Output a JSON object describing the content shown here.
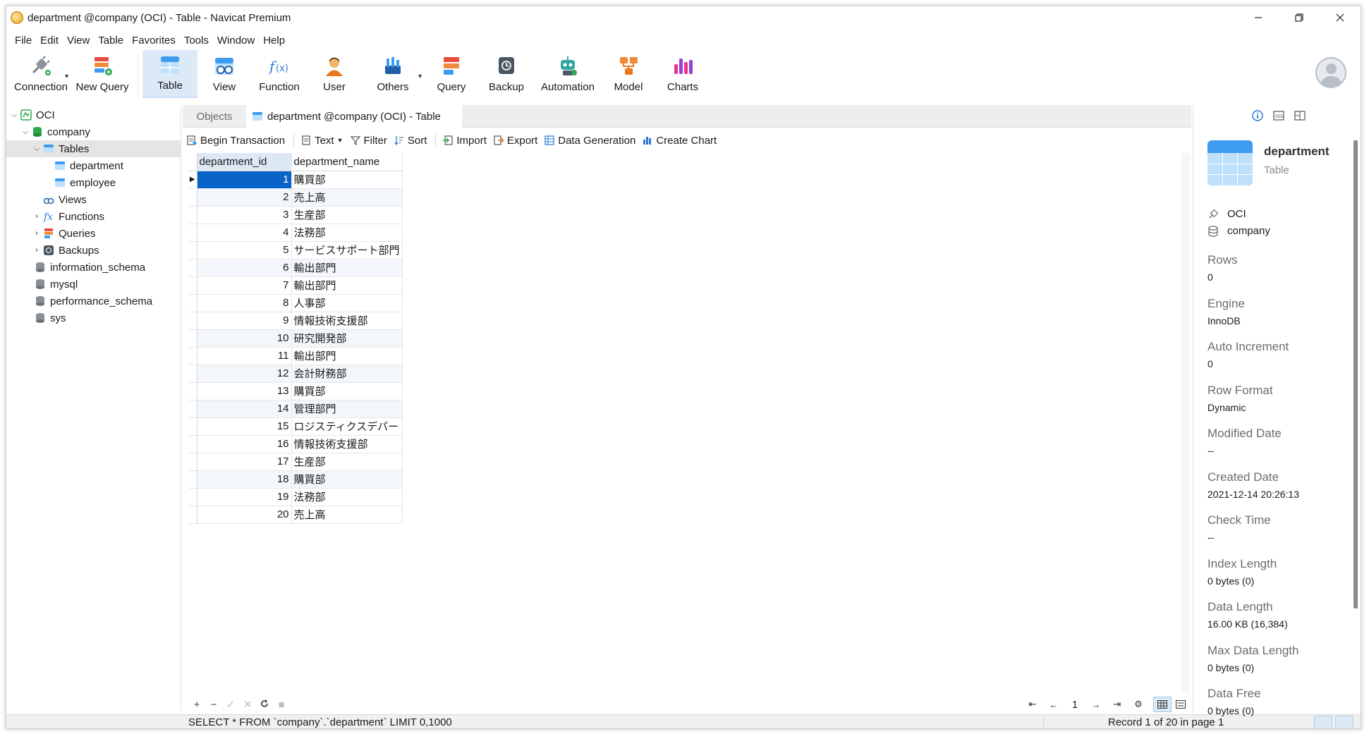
{
  "window": {
    "title": "department @company (OCI) - Table - Navicat Premium"
  },
  "menu": [
    "File",
    "Edit",
    "View",
    "Table",
    "Favorites",
    "Tools",
    "Window",
    "Help"
  ],
  "toolbar": {
    "connection": "Connection",
    "new_query": "New Query",
    "table": "Table",
    "view": "View",
    "function": "Function",
    "user": "User",
    "others": "Others",
    "query": "Query",
    "backup": "Backup",
    "automation": "Automation",
    "model": "Model",
    "charts": "Charts"
  },
  "tree": {
    "connection": "OCI",
    "database": "company",
    "tables": "Tables",
    "table_items": [
      "department",
      "employee"
    ],
    "views": "Views",
    "functions": "Functions",
    "queries": "Queries",
    "backups": "Backups",
    "other_dbs": [
      "information_schema",
      "mysql",
      "performance_schema",
      "sys"
    ]
  },
  "tabs": {
    "objects": "Objects",
    "active": "department @company (OCI) - Table"
  },
  "object_toolbar": {
    "begin_transaction": "Begin Transaction",
    "text": "Text",
    "filter": "Filter",
    "sort": "Sort",
    "import": "Import",
    "export": "Export",
    "data_generation": "Data Generation",
    "create_chart": "Create Chart"
  },
  "grid": {
    "columns": [
      "department_id",
      "department_name"
    ],
    "rows": [
      [
        "1",
        "購買部"
      ],
      [
        "2",
        "売上高"
      ],
      [
        "3",
        "生産部"
      ],
      [
        "4",
        "法務部"
      ],
      [
        "5",
        "サービスサポート部門"
      ],
      [
        "6",
        "輸出部門"
      ],
      [
        "7",
        "輸出部門"
      ],
      [
        "8",
        "人事部"
      ],
      [
        "9",
        "情報技術支援部"
      ],
      [
        "10",
        "研究開発部"
      ],
      [
        "11",
        "輸出部門"
      ],
      [
        "12",
        "会計財務部"
      ],
      [
        "13",
        "購買部"
      ],
      [
        "14",
        "管理部門"
      ],
      [
        "15",
        "ロジスティクスデパー"
      ],
      [
        "16",
        "情報技術支援部"
      ],
      [
        "17",
        "生産部"
      ],
      [
        "18",
        "購買部"
      ],
      [
        "19",
        "法務部"
      ],
      [
        "20",
        "売上高"
      ]
    ]
  },
  "pager": {
    "page": "1"
  },
  "status": {
    "sql": "SELECT * FROM `company`.`department` LIMIT 0,1000",
    "record": "Record 1 of 20 in page 1"
  },
  "info": {
    "name": "department",
    "type": "Table",
    "connection": "OCI",
    "database": "company",
    "fields": [
      {
        "label": "Rows",
        "value": "0"
      },
      {
        "label": "Engine",
        "value": "InnoDB"
      },
      {
        "label": "Auto Increment",
        "value": "0"
      },
      {
        "label": "Row Format",
        "value": "Dynamic"
      },
      {
        "label": "Modified Date",
        "value": "--"
      },
      {
        "label": "Created Date",
        "value": "2021-12-14 20:26:13"
      },
      {
        "label": "Check Time",
        "value": "--"
      },
      {
        "label": "Index Length",
        "value": "0 bytes (0)"
      },
      {
        "label": "Data Length",
        "value": "16.00 KB (16,384)"
      },
      {
        "label": "Max Data Length",
        "value": "0 bytes (0)"
      },
      {
        "label": "Data Free",
        "value": "0 bytes (0)"
      }
    ]
  },
  "colors": {
    "accent": "#0a63c9",
    "active_toolbar": "#dce9f7",
    "table_icon": "#3d9cf0"
  }
}
